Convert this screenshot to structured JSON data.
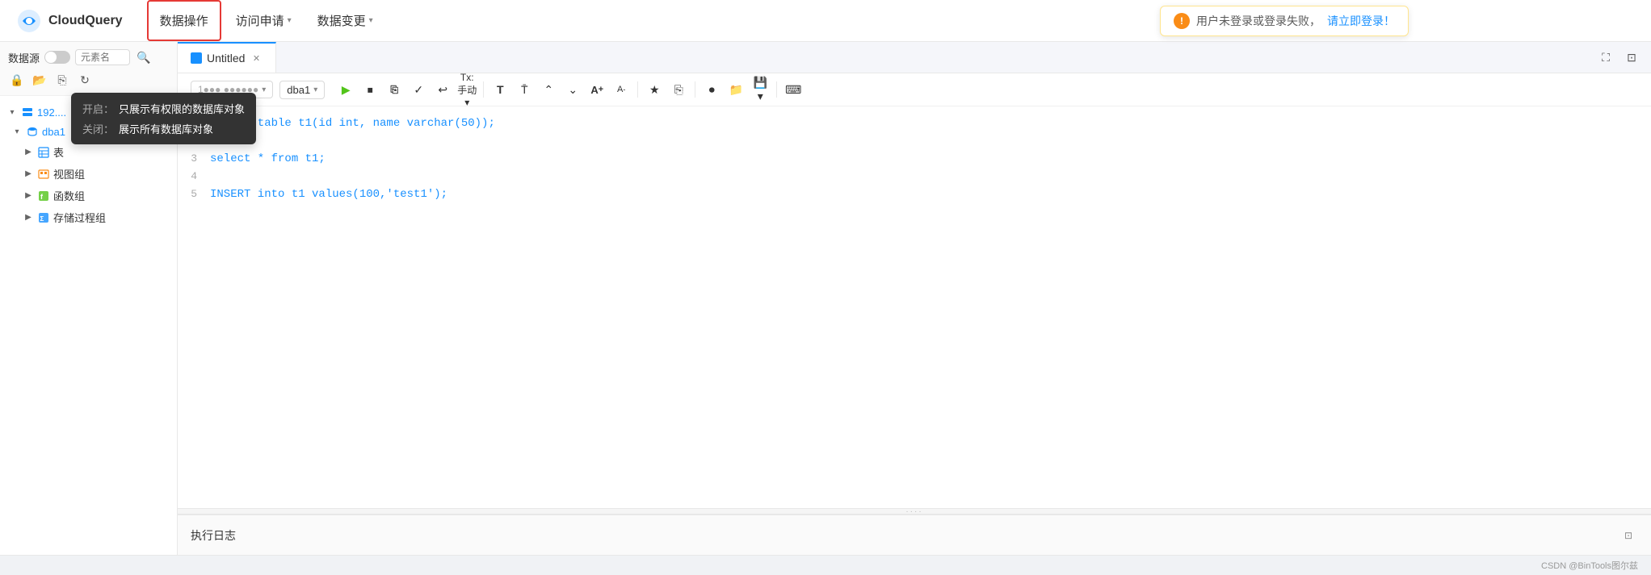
{
  "app": {
    "logo_text": "CloudQuery"
  },
  "nav": {
    "items": [
      {
        "label": "数据操作",
        "active": true,
        "has_dropdown": false
      },
      {
        "label": "访问申请",
        "active": false,
        "has_dropdown": true
      },
      {
        "label": "数据变更",
        "active": false,
        "has_dropdown": true
      }
    ]
  },
  "notification": {
    "icon_text": "!",
    "message": "用户未登录或登录失败，",
    "link_text": "请立即登录！"
  },
  "sidebar": {
    "label": "数据源",
    "search_placeholder": "元素名",
    "tooltip": {
      "on_label": "开启：",
      "on_value": "只展示有权限的数据库对象",
      "off_label": "关闭：",
      "off_value": "展示所有数据库对象"
    },
    "tree": {
      "host_label": "192.",
      "db_label": "dba1",
      "children": [
        {
          "label": "表",
          "icon": "table"
        },
        {
          "label": "视图组",
          "icon": "view"
        },
        {
          "label": "函数组",
          "icon": "function"
        },
        {
          "label": "存储过程组",
          "icon": "procedure"
        }
      ]
    }
  },
  "tabs": {
    "items": [
      {
        "label": "Untitled",
        "active": true
      }
    ],
    "expand_label": "⛶",
    "collapse_label": "⊡"
  },
  "editor": {
    "db_select_1": "1●●● ●●●●●●",
    "db_select_2": "dba1",
    "toolbar": {
      "play": "▶",
      "stop": "⏹",
      "copy": "⧉",
      "check": "✓",
      "undo": "↩",
      "tx_label": "Tx: 手动",
      "format_T": "T↕",
      "format_up": "⬆",
      "format_down": "⬇",
      "font_up": "A+",
      "font_down": "A-",
      "star": "★",
      "save_as": "⎘",
      "record": "⏺",
      "folder": "📁",
      "save": "💾",
      "terminal": "⌨"
    },
    "lines": [
      {
        "number": "1",
        "content": "create table t1(id int, name varchar(50));"
      },
      {
        "number": "2",
        "content": ""
      },
      {
        "number": "3",
        "content": "select * from t1;"
      },
      {
        "number": "4",
        "content": ""
      },
      {
        "number": "5",
        "content": "INSERT into t1 values(100,'test1');"
      }
    ]
  },
  "log_panel": {
    "label": "执行日志"
  },
  "footer": {
    "text": "CSDN @BinTools图尔兹"
  }
}
